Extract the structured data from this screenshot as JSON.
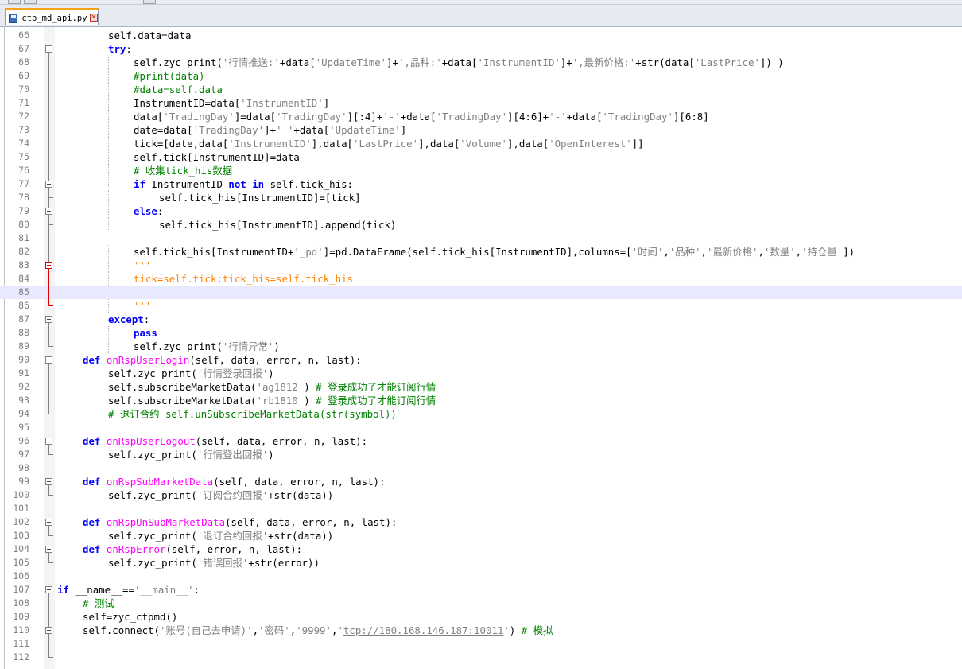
{
  "tab": {
    "filename": "ctp_md_api.py",
    "close_glyph": "✕"
  },
  "editor": {
    "lines": [
      {
        "n": "66",
        "indent": 2,
        "segs": [
          [
            "t",
            "self.data=data"
          ]
        ]
      },
      {
        "n": "67",
        "indent": 2,
        "segs": [
          [
            "k",
            "try"
          ],
          [
            "t",
            ":"
          ]
        ]
      },
      {
        "n": "68",
        "indent": 3,
        "segs": [
          [
            "t",
            "self.zyc_print("
          ],
          [
            "s",
            "'行情推送:'"
          ],
          [
            "t",
            "+data["
          ],
          [
            "s",
            "'UpdateTime'"
          ],
          [
            "t",
            "]+"
          ],
          [
            "s",
            "',品种:'"
          ],
          [
            "t",
            "+data["
          ],
          [
            "s",
            "'InstrumentID'"
          ],
          [
            "t",
            "]+"
          ],
          [
            "s",
            "',最新价格:'"
          ],
          [
            "t",
            "+str(data["
          ],
          [
            "s",
            "'LastPrice'"
          ],
          [
            "t",
            "]) )"
          ]
        ]
      },
      {
        "n": "69",
        "indent": 3,
        "segs": [
          [
            "c",
            "#print(data)"
          ]
        ]
      },
      {
        "n": "70",
        "indent": 3,
        "segs": [
          [
            "c",
            "#data=self.data"
          ]
        ]
      },
      {
        "n": "71",
        "indent": 3,
        "segs": [
          [
            "t",
            "InstrumentID=data["
          ],
          [
            "s",
            "'InstrumentID'"
          ],
          [
            "t",
            "]"
          ]
        ]
      },
      {
        "n": "72",
        "indent": 3,
        "segs": [
          [
            "t",
            "data["
          ],
          [
            "s",
            "'TradingDay'"
          ],
          [
            "t",
            "]=data["
          ],
          [
            "s",
            "'TradingDay'"
          ],
          [
            "t",
            "][:4]+"
          ],
          [
            "s",
            "'-'"
          ],
          [
            "t",
            "+data["
          ],
          [
            "s",
            "'TradingDay'"
          ],
          [
            "t",
            "][4:6]+"
          ],
          [
            "s",
            "'-'"
          ],
          [
            "t",
            "+data["
          ],
          [
            "s",
            "'TradingDay'"
          ],
          [
            "t",
            "][6:8]"
          ]
        ]
      },
      {
        "n": "73",
        "indent": 3,
        "segs": [
          [
            "t",
            "date=data["
          ],
          [
            "s",
            "'TradingDay'"
          ],
          [
            "t",
            "]+"
          ],
          [
            "s",
            "' '"
          ],
          [
            "t",
            "+data["
          ],
          [
            "s",
            "'UpdateTime'"
          ],
          [
            "t",
            "]"
          ]
        ]
      },
      {
        "n": "74",
        "indent": 3,
        "segs": [
          [
            "t",
            "tick=[date,data["
          ],
          [
            "s",
            "'InstrumentID'"
          ],
          [
            "t",
            "],data["
          ],
          [
            "s",
            "'LastPrice'"
          ],
          [
            "t",
            "],data["
          ],
          [
            "s",
            "'Volume'"
          ],
          [
            "t",
            "],data["
          ],
          [
            "s",
            "'OpenInterest'"
          ],
          [
            "t",
            "]]"
          ]
        ]
      },
      {
        "n": "75",
        "indent": 3,
        "segs": [
          [
            "t",
            "self.tick[InstrumentID]=data"
          ]
        ]
      },
      {
        "n": "76",
        "indent": 3,
        "segs": [
          [
            "c",
            "# 收集tick_his数据"
          ]
        ]
      },
      {
        "n": "77",
        "indent": 3,
        "segs": [
          [
            "k",
            "if"
          ],
          [
            "t",
            " InstrumentID "
          ],
          [
            "k",
            "not in"
          ],
          [
            "t",
            " self.tick_his:"
          ]
        ]
      },
      {
        "n": "78",
        "indent": 4,
        "segs": [
          [
            "t",
            "self.tick_his[InstrumentID]=[tick]"
          ]
        ]
      },
      {
        "n": "79",
        "indent": 3,
        "segs": [
          [
            "k",
            "else"
          ],
          [
            "t",
            ":"
          ]
        ]
      },
      {
        "n": "80",
        "indent": 4,
        "segs": [
          [
            "t",
            "self.tick_his[InstrumentID].append(tick)"
          ]
        ]
      },
      {
        "n": "81",
        "indent": 0,
        "segs": []
      },
      {
        "n": "82",
        "indent": 3,
        "segs": [
          [
            "t",
            "self.tick_his[InstrumentID+"
          ],
          [
            "s",
            "'_pd'"
          ],
          [
            "t",
            "]=pd.DataFrame(self.tick_his[InstrumentID],columns=["
          ],
          [
            "s",
            "'时间'"
          ],
          [
            "t",
            ","
          ],
          [
            "s",
            "'品种'"
          ],
          [
            "t",
            ","
          ],
          [
            "s",
            "'最新价格'"
          ],
          [
            "t",
            ","
          ],
          [
            "s",
            "'数量'"
          ],
          [
            "t",
            ","
          ],
          [
            "s",
            "'持仓量'"
          ],
          [
            "t",
            "])"
          ]
        ]
      },
      {
        "n": "83",
        "indent": 3,
        "segs": [
          [
            "d",
            "'''"
          ]
        ]
      },
      {
        "n": "84",
        "indent": 3,
        "segs": [
          [
            "d",
            "tick=self.tick;tick_his=self.tick_his"
          ]
        ]
      },
      {
        "n": "85",
        "indent": 0,
        "segs": []
      },
      {
        "n": "86",
        "indent": 3,
        "segs": [
          [
            "d",
            "'''"
          ]
        ]
      },
      {
        "n": "87",
        "indent": 2,
        "segs": [
          [
            "k",
            "except"
          ],
          [
            "t",
            ":"
          ]
        ]
      },
      {
        "n": "88",
        "indent": 3,
        "segs": [
          [
            "k",
            "pass"
          ]
        ]
      },
      {
        "n": "89",
        "indent": 3,
        "segs": [
          [
            "t",
            "self.zyc_print("
          ],
          [
            "s",
            "'行情异常'"
          ],
          [
            "t",
            ")"
          ]
        ]
      },
      {
        "n": "90",
        "indent": 1,
        "segs": [
          [
            "k",
            "def"
          ],
          [
            "t",
            " "
          ],
          [
            "f",
            "onRspUserLogin"
          ],
          [
            "t",
            "(self, data, error, n, last):"
          ]
        ]
      },
      {
        "n": "91",
        "indent": 2,
        "segs": [
          [
            "t",
            "self.zyc_print("
          ],
          [
            "s",
            "'行情登录回报'"
          ],
          [
            "t",
            ")"
          ]
        ]
      },
      {
        "n": "92",
        "indent": 2,
        "segs": [
          [
            "t",
            "self.subscribeMarketData("
          ],
          [
            "s",
            "'ag1812'"
          ],
          [
            "t",
            ") "
          ],
          [
            "c",
            "# 登录成功了才能订阅行情"
          ]
        ]
      },
      {
        "n": "93",
        "indent": 2,
        "segs": [
          [
            "t",
            "self.subscribeMarketData("
          ],
          [
            "s",
            "'rb1810'"
          ],
          [
            "t",
            ") "
          ],
          [
            "c",
            "# 登录成功了才能订阅行情"
          ]
        ]
      },
      {
        "n": "94",
        "indent": 2,
        "segs": [
          [
            "c",
            "# 退订合约 self.unSubscribeMarketData(str(symbol))"
          ]
        ]
      },
      {
        "n": "95",
        "indent": 0,
        "segs": []
      },
      {
        "n": "96",
        "indent": 1,
        "segs": [
          [
            "k",
            "def"
          ],
          [
            "t",
            " "
          ],
          [
            "f",
            "onRspUserLogout"
          ],
          [
            "t",
            "(self, data, error, n, last):"
          ]
        ]
      },
      {
        "n": "97",
        "indent": 2,
        "segs": [
          [
            "t",
            "self.zyc_print("
          ],
          [
            "s",
            "'行情登出回报'"
          ],
          [
            "t",
            ")"
          ]
        ]
      },
      {
        "n": "98",
        "indent": 0,
        "segs": []
      },
      {
        "n": "99",
        "indent": 1,
        "segs": [
          [
            "k",
            "def"
          ],
          [
            "t",
            " "
          ],
          [
            "f",
            "onRspSubMarketData"
          ],
          [
            "t",
            "(self, data, error, n, last):"
          ]
        ]
      },
      {
        "n": "100",
        "indent": 2,
        "segs": [
          [
            "t",
            "self.zyc_print("
          ],
          [
            "s",
            "'订阅合约回报'"
          ],
          [
            "t",
            "+str(data))"
          ]
        ]
      },
      {
        "n": "101",
        "indent": 0,
        "segs": []
      },
      {
        "n": "102",
        "indent": 1,
        "segs": [
          [
            "k",
            "def"
          ],
          [
            "t",
            " "
          ],
          [
            "f",
            "onRspUnSubMarketData"
          ],
          [
            "t",
            "(self, data, error, n, last):"
          ]
        ]
      },
      {
        "n": "103",
        "indent": 2,
        "segs": [
          [
            "t",
            "self.zyc_print("
          ],
          [
            "s",
            "'退订合约回报'"
          ],
          [
            "t",
            "+str(data))"
          ]
        ]
      },
      {
        "n": "104",
        "indent": 1,
        "segs": [
          [
            "k",
            "def"
          ],
          [
            "t",
            " "
          ],
          [
            "f",
            "onRspError"
          ],
          [
            "t",
            "(self, error, n, last):"
          ]
        ]
      },
      {
        "n": "105",
        "indent": 2,
        "segs": [
          [
            "t",
            "self.zyc_print("
          ],
          [
            "s",
            "'错误回报'"
          ],
          [
            "t",
            "+str(error))"
          ]
        ]
      },
      {
        "n": "106",
        "indent": 0,
        "segs": []
      },
      {
        "n": "107",
        "indent": 0,
        "segs": [
          [
            "k",
            "if"
          ],
          [
            "t",
            " __name__=="
          ],
          [
            "s",
            "'__main__'"
          ],
          [
            "t",
            ":"
          ]
        ]
      },
      {
        "n": "108",
        "indent": 1,
        "segs": [
          [
            "c",
            "# 测试"
          ]
        ]
      },
      {
        "n": "109",
        "indent": 1,
        "segs": [
          [
            "t",
            "self=zyc_ctpmd()"
          ]
        ]
      },
      {
        "n": "110",
        "indent": 1,
        "segs": [
          [
            "t",
            "self.connect("
          ],
          [
            "s",
            "'账号(自己去申请)'"
          ],
          [
            "t",
            ","
          ],
          [
            "s",
            "'密码'"
          ],
          [
            "t",
            ","
          ],
          [
            "s",
            "'9999'"
          ],
          [
            "t",
            ","
          ],
          [
            "s",
            "'"
          ],
          [
            "u",
            "tcp://180.168.146.187:10011"
          ],
          [
            "s",
            "'"
          ],
          [
            "t",
            ") "
          ],
          [
            "c",
            "# 模拟"
          ]
        ]
      },
      {
        "n": "111",
        "indent": 0,
        "segs": []
      },
      {
        "n": "112",
        "indent": 0,
        "segs": []
      }
    ]
  }
}
